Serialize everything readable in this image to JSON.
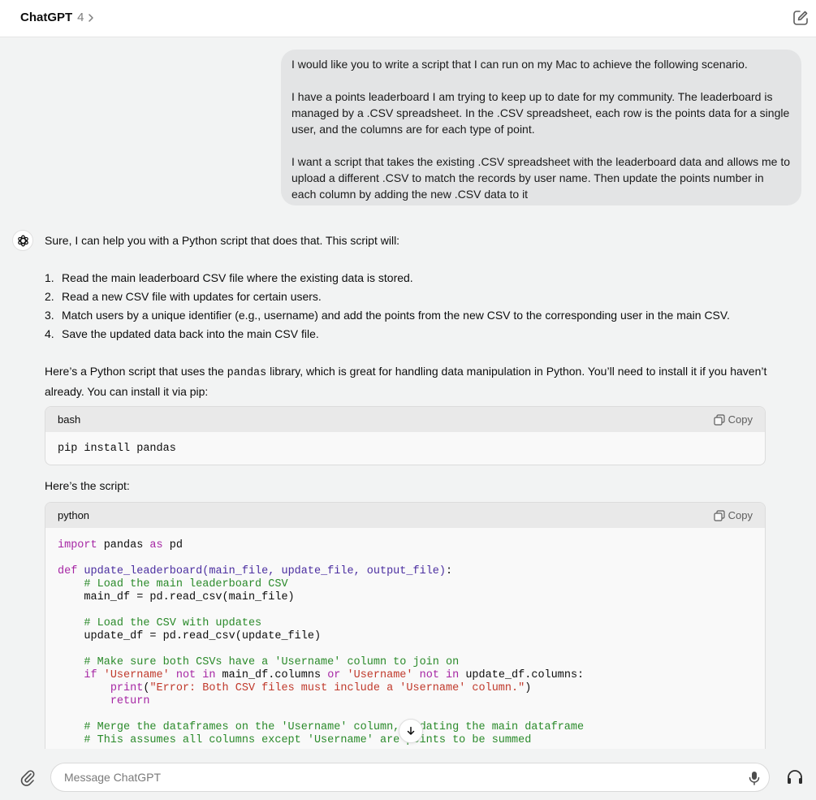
{
  "header": {
    "app_name": "ChatGPT",
    "version": "4"
  },
  "user_message": {
    "paragraphs": [
      "I would like you to write a script that I can run on my Mac to achieve the following scenario.",
      "I have a points leaderboard I am trying to keep up to date for my community. The leaderboard is managed by a .CSV spreadsheet. In the .CSV spreadsheet, each row is the points data for a single user, and the columns are for each type of point.",
      "I want a script that takes the existing .CSV spreadsheet with the leaderboard data and allows me to upload a different .CSV to match the records by user name. Then update the points number in each column by adding the new .CSV data to it"
    ]
  },
  "assistant": {
    "intro": "Sure, I can help you with a Python script that does that. This script will:",
    "steps": [
      "Read the main leaderboard CSV file where the existing data is stored.",
      "Read a new CSV file with updates for certain users.",
      "Match users by a unique identifier (e.g., username) and add the points from the new CSV to the corresponding user in the main CSV.",
      "Save the updated data back into the main CSV file."
    ],
    "para2_before": "Here’s a Python script that uses the ",
    "para2_code": "pandas",
    "para2_after": " library, which is great for handling data manipulation in Python. You’ll need to install it if you haven’t already. You can install it via pip:",
    "para3": "Here’s the script:",
    "code_blocks": [
      {
        "lang": "bash",
        "copy_label": "Copy",
        "code": "pip install pandas"
      },
      {
        "lang": "python",
        "copy_label": "Copy"
      }
    ]
  },
  "composer": {
    "placeholder": "Message ChatGPT"
  }
}
